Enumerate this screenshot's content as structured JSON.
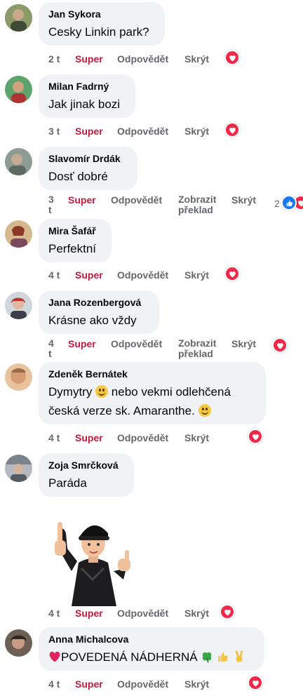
{
  "labels": {
    "like": "Super",
    "reply": "Odpovědět",
    "hide": "Skrýt",
    "translate": "Zobrazit překlad"
  },
  "comments": [
    {
      "author": "Jan Sykora",
      "text": "Cesky Linkin park?",
      "time": "2 t",
      "avatar_color": "#6b7a4f"
    },
    {
      "author": "Milan Fadrný",
      "text": "Jak jinak bozi",
      "time": "3 t",
      "avatar_color": "#4f8a5a"
    },
    {
      "author": "Slavomír Drdák",
      "text": "Dosť dobré",
      "time": "3 t",
      "time_a": "3",
      "time_b": "t",
      "avatar_color": "#7d8d86",
      "reaction_count": "2"
    },
    {
      "author": "Mira Šafář",
      "text": "Perfektní",
      "time": "4 t",
      "avatar_color": "#a8775a"
    },
    {
      "author": "Jana Rozenbergová",
      "text": "Krásne ako vždy",
      "time": "4 t",
      "time_a": "4",
      "time_b": "t",
      "avatar_color": "#c0504d"
    },
    {
      "author": "Zdeněk Bernátek",
      "text_line1": "Dymytry",
      "text_line1b": "nebo vekmi odlehčená",
      "text_line2": "česká verze sk. Amaranthe.",
      "time": "4 t",
      "avatar_color": "#c69872"
    },
    {
      "author": "Zoja Smrčková",
      "text": "Paráda",
      "time": "4 t",
      "avatar_color": "#8a8f96"
    },
    {
      "author": "Anna Michalcova",
      "text": "POVEDENÁ NÁDHERNÁ",
      "time": "4 t",
      "avatar_color": "#5b4a3e"
    }
  ],
  "icons": {
    "heart": "heart-icon",
    "like": "thumbs-up-icon",
    "smile": "smile-emoji",
    "clover": "clover-emoji",
    "victory": "victory-hand-emoji"
  },
  "colors": {
    "bubble": "#f0f2f5",
    "super": "#c4183c",
    "meta": "#65676b",
    "heart": "#f0284a",
    "like_blue": "#1877f2"
  }
}
